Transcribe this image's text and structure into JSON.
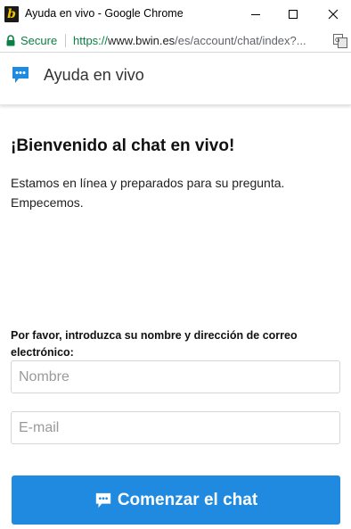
{
  "window": {
    "title": "Ayuda en vivo - Google Chrome",
    "logo_letter": "b",
    "controls": [
      "minimize",
      "maximize",
      "close"
    ]
  },
  "address_bar": {
    "secure_label": "Secure",
    "url_scheme": "https://",
    "url_host": "www.bwin.es",
    "url_path": "/es/account/chat/index?..."
  },
  "chat_header": {
    "icon": "chat-bubble-icon",
    "title": "Ayuda en vivo",
    "accent_color": "#1f8ae0"
  },
  "content": {
    "welcome_title": "¡Bienvenido al chat en vivo!",
    "welcome_line1": "Estamos en línea y preparados para su pregunta.",
    "welcome_line2": "Empecemos."
  },
  "form": {
    "label": "Por favor, introduzca su nombre y dirección de correo electrónico:",
    "name_placeholder": "Nombre",
    "email_placeholder": "E-mail"
  },
  "start_button": {
    "label": "Comenzar el chat",
    "icon": "chat-bubble-icon",
    "color": "#1f8ae0"
  }
}
